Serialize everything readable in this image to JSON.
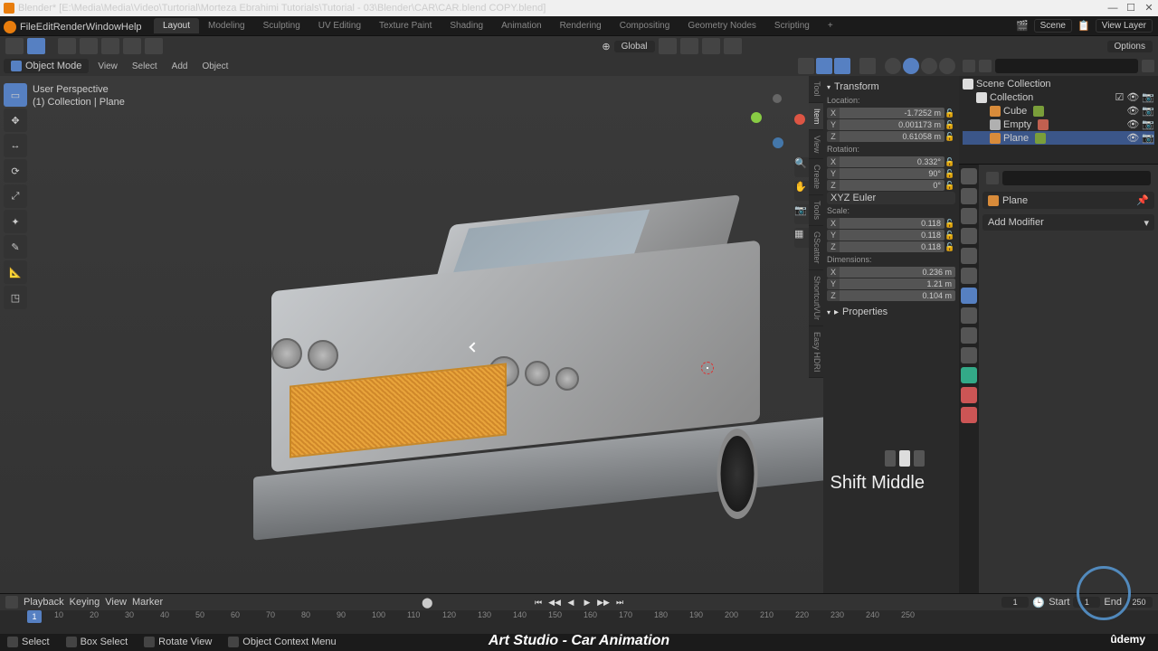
{
  "window": {
    "title": "Blender* [E:\\Media\\Media\\Video\\Turtorial\\Morteza Ebrahimi Tutorials\\Tutorial - 03\\Blender\\CAR\\CAR.blend COPY.blend]"
  },
  "top_menu": [
    "File",
    "Edit",
    "Render",
    "Window",
    "Help"
  ],
  "workspaces": [
    "Layout",
    "Modeling",
    "Sculpting",
    "UV Editing",
    "Texture Paint",
    "Shading",
    "Animation",
    "Rendering",
    "Compositing",
    "Geometry Nodes",
    "Scripting"
  ],
  "scene_field": "Scene",
  "viewlayer_field": "View Layer",
  "toolbar2": {
    "global": "Global",
    "options": "Options"
  },
  "vp_header": {
    "mode": "Object Mode",
    "menus": [
      "View",
      "Select",
      "Add",
      "Object"
    ]
  },
  "overlay": {
    "line1": "User Perspective",
    "line2": "(1) Collection | Plane"
  },
  "npanel": {
    "transform": "Transform",
    "location": "Location:",
    "rotation": "Rotation:",
    "scale": "Scale:",
    "dimensions": "Dimensions:",
    "properties": "Properties",
    "rotmode": "XYZ Euler",
    "loc": {
      "x": "-1.7252 m",
      "y": "0.001173 m",
      "z": "0.61058 m"
    },
    "rot": {
      "x": "0.332°",
      "y": "90°",
      "z": "0°"
    },
    "scl": {
      "x": "0.118",
      "y": "0.118",
      "z": "0.118"
    },
    "dim": {
      "x": "0.236 m",
      "y": "1.21 m",
      "z": "0.104 m"
    },
    "tabs": [
      "Tool",
      "Item",
      "View",
      "Create",
      "Tools",
      "GScatter",
      "ShortcutVUr",
      "Easy HDRI"
    ]
  },
  "outliner": {
    "root": "Scene Collection",
    "collection": "Collection",
    "items": [
      {
        "name": "Cube",
        "color": "#d88b3a"
      },
      {
        "name": "Empty",
        "color": "#b0b0b0"
      },
      {
        "name": "Plane",
        "color": "#d88b3a",
        "selected": true
      }
    ]
  },
  "props": {
    "object": "Plane",
    "addmod": "Add Modifier"
  },
  "timeline": {
    "menus": [
      "Playback",
      "Keying",
      "View",
      "Marker"
    ],
    "current": "1",
    "start_lbl": "Start",
    "start": "1",
    "end_lbl": "End",
    "end": "250",
    "ticks": [
      "10",
      "20",
      "30",
      "40",
      "50",
      "60",
      "70",
      "80",
      "90",
      "100",
      "110",
      "120",
      "130",
      "140",
      "150",
      "160",
      "170",
      "180",
      "190",
      "200",
      "210",
      "220",
      "230",
      "240",
      "250"
    ]
  },
  "status": {
    "select": "Select",
    "box": "Box Select",
    "rotate": "Rotate View",
    "ctx": "Object Context Menu"
  },
  "overlay_shortcut": "Shift Middle",
  "caption": "Art Studio - Car Animation",
  "udemy": "ûdemy"
}
